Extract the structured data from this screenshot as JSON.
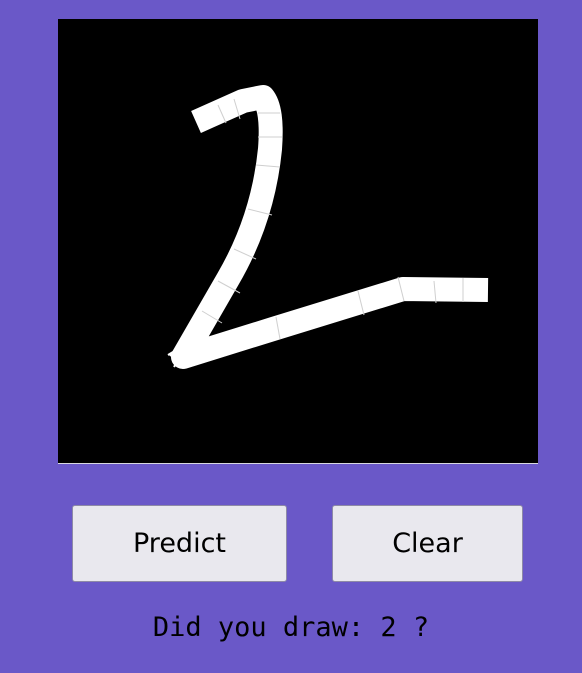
{
  "drawing_canvas": {
    "background": "#000000",
    "stroke_color": "#ffffff",
    "drawn_digit": "2"
  },
  "buttons": {
    "predict_label": "Predict",
    "clear_label": "Clear"
  },
  "result": {
    "text": "Did you draw: 2 ?"
  },
  "colors": {
    "window_background": "#6a58c8",
    "button_face": "#e9e8ee"
  }
}
